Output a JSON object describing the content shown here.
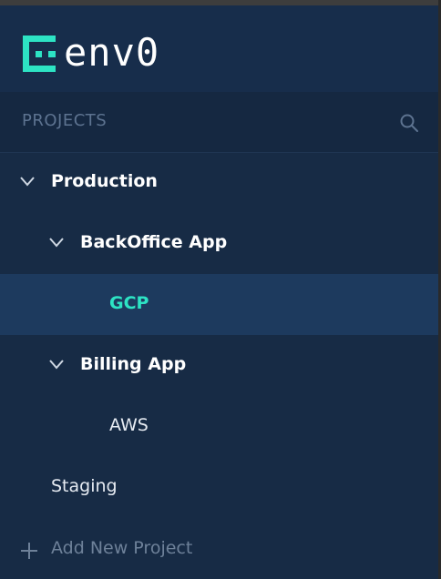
{
  "app": {
    "logo_text": "env0"
  },
  "projects_header": {
    "label": "PROJECTS",
    "search_icon": "search-icon"
  },
  "tree": {
    "production": {
      "label": "Production",
      "expanded": true
    },
    "backoffice": {
      "label": "BackOffice App",
      "expanded": true
    },
    "gcp": {
      "label": "GCP",
      "selected": true
    },
    "billing": {
      "label": "Billing App",
      "expanded": true
    },
    "aws": {
      "label": "AWS"
    },
    "staging": {
      "label": "Staging"
    }
  },
  "add_project": {
    "label": "Add New Project",
    "icon": "plus-icon"
  },
  "colors": {
    "background": "#172b45",
    "selected_row": "#1d3a5e",
    "accent": "#2de3c4",
    "muted": "#5d7390"
  }
}
